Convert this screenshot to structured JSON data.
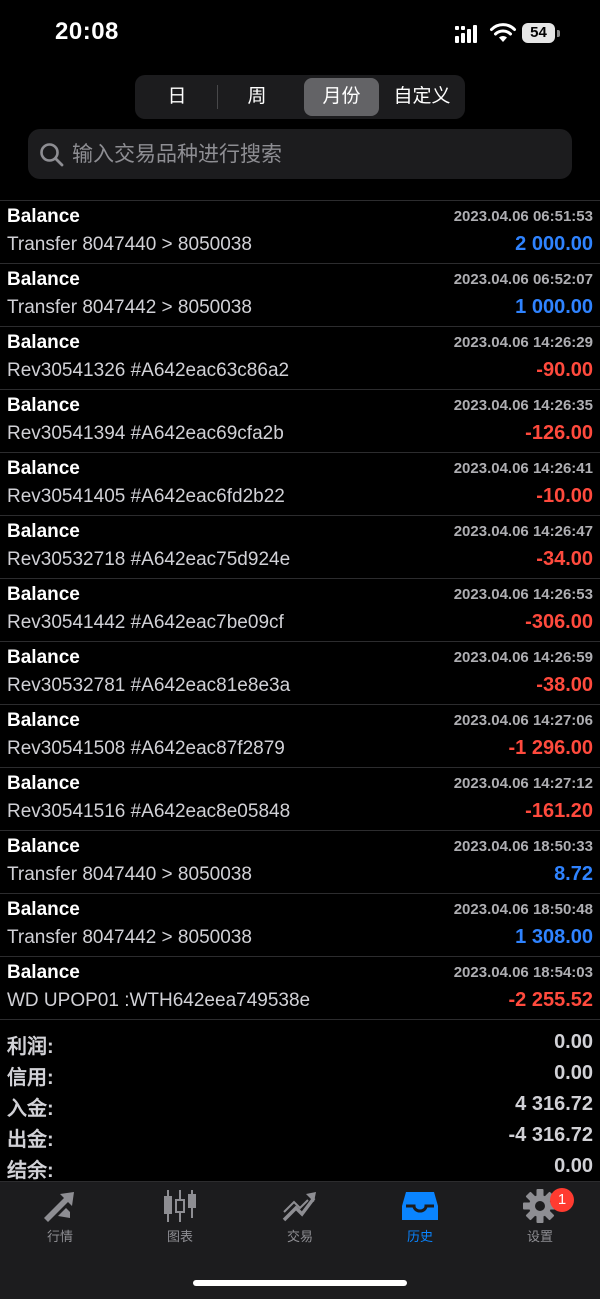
{
  "status_bar": {
    "time": "20:08",
    "battery": "54"
  },
  "period_tabs": [
    {
      "label": "日",
      "active": false
    },
    {
      "label": "周",
      "active": false
    },
    {
      "label": "月份",
      "active": true
    },
    {
      "label": "自定义",
      "active": false
    }
  ],
  "search": {
    "placeholder": "输入交易品种进行搜索"
  },
  "colors": {
    "positive": "#2f83ff",
    "negative": "#ff4a3d"
  },
  "transactions": [
    {
      "type": "Balance",
      "time": "2023.04.06 06:51:53",
      "comment": "Transfer 8047440 > 8050038",
      "amount": "2 000.00",
      "sign": "positive"
    },
    {
      "type": "Balance",
      "time": "2023.04.06 06:52:07",
      "comment": "Transfer 8047442 > 8050038",
      "amount": "1 000.00",
      "sign": "positive"
    },
    {
      "type": "Balance",
      "time": "2023.04.06 14:26:29",
      "comment": "Rev30541326 #A642eac63c86a2",
      "amount": "-90.00",
      "sign": "negative"
    },
    {
      "type": "Balance",
      "time": "2023.04.06 14:26:35",
      "comment": "Rev30541394 #A642eac69cfa2b",
      "amount": "-126.00",
      "sign": "negative"
    },
    {
      "type": "Balance",
      "time": "2023.04.06 14:26:41",
      "comment": "Rev30541405 #A642eac6fd2b22",
      "amount": "-10.00",
      "sign": "negative"
    },
    {
      "type": "Balance",
      "time": "2023.04.06 14:26:47",
      "comment": "Rev30532718 #A642eac75d924e",
      "amount": "-34.00",
      "sign": "negative"
    },
    {
      "type": "Balance",
      "time": "2023.04.06 14:26:53",
      "comment": "Rev30541442 #A642eac7be09cf",
      "amount": "-306.00",
      "sign": "negative"
    },
    {
      "type": "Balance",
      "time": "2023.04.06 14:26:59",
      "comment": "Rev30532781 #A642eac81e8e3a",
      "amount": "-38.00",
      "sign": "negative"
    },
    {
      "type": "Balance",
      "time": "2023.04.06 14:27:06",
      "comment": "Rev30541508 #A642eac87f2879",
      "amount": "-1 296.00",
      "sign": "negative"
    },
    {
      "type": "Balance",
      "time": "2023.04.06 14:27:12",
      "comment": "Rev30541516 #A642eac8e05848",
      "amount": "-161.20",
      "sign": "negative"
    },
    {
      "type": "Balance",
      "time": "2023.04.06 18:50:33",
      "comment": "Transfer 8047440 > 8050038",
      "amount": "8.72",
      "sign": "positive"
    },
    {
      "type": "Balance",
      "time": "2023.04.06 18:50:48",
      "comment": "Transfer 8047442 > 8050038",
      "amount": "1 308.00",
      "sign": "positive"
    },
    {
      "type": "Balance",
      "time": "2023.04.06 18:54:03",
      "comment": "WD UPOP01 :WTH642eea749538e",
      "amount": "-2 255.52",
      "sign": "negative"
    }
  ],
  "summary": [
    {
      "label": "利润:",
      "value": "0.00"
    },
    {
      "label": "信用:",
      "value": "0.00"
    },
    {
      "label": "入金:",
      "value": "4 316.72"
    },
    {
      "label": "出金:",
      "value": "-4 316.72"
    },
    {
      "label": "结余:",
      "value": "0.00"
    }
  ],
  "tabbar": [
    {
      "label": "行情",
      "icon": "quotes-arrows-icon",
      "active": false
    },
    {
      "label": "图表",
      "icon": "candlestick-chart-icon",
      "active": false
    },
    {
      "label": "交易",
      "icon": "trade-trend-icon",
      "active": false
    },
    {
      "label": "历史",
      "icon": "history-inbox-icon",
      "active": true
    },
    {
      "label": "设置",
      "icon": "gear-icon",
      "active": false,
      "badge": "1"
    }
  ]
}
